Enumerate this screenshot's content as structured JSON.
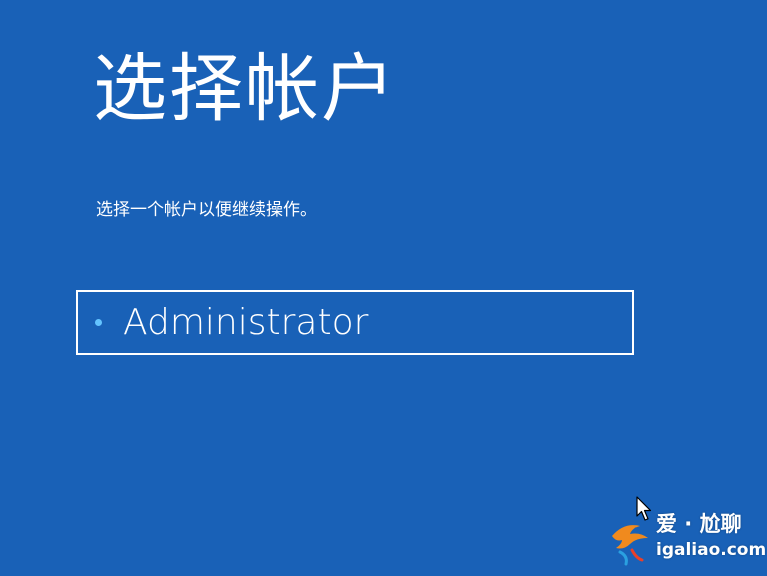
{
  "screen": {
    "title": "选择帐户",
    "subtitle": "选择一个帐户以便继续操作。"
  },
  "accounts": [
    {
      "name": "Administrator"
    }
  ],
  "watermark": {
    "line1": "爱 · 尬聊",
    "line2": "igaliao.com"
  },
  "colors": {
    "background": "#1961b7",
    "text": "#ffffff",
    "dot": "#64c4ff"
  }
}
